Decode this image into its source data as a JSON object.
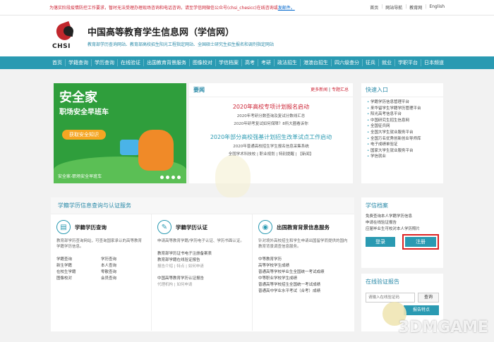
{
  "topbar": {
    "notice": "为落实阶段疫情防控工作要求，暂时无法受理办理现场咨询和电话咨询，请至学信网微信公众号(chsi_chesicc)在线咨询或",
    "notice_link": "发邮件。",
    "links": [
      "首页",
      "网站导航",
      "教育网",
      "English"
    ]
  },
  "header": {
    "logo_text": "CHSI",
    "title": "中国高等教育学生信息网（学信网）",
    "subtitle": "教育部学历查询网站、教育部高校招生阳光工程指定网站、全国硕士研究生招生报名和调剂指定网站"
  },
  "nav": [
    "首页",
    "学籍查询",
    "学历查询",
    "在线验证",
    "出国教育背景服务",
    "图像校对",
    "学信档案",
    "高考",
    "考研",
    "政法招生",
    "港澳台招生",
    "四六级查分",
    "征兵",
    "就业",
    "学职平台",
    "日本频道"
  ],
  "banner": {
    "title": "安全家",
    "subtitle": "职场安全早班车",
    "button": "获取安全知识",
    "caption": "安全家-职场安全早班车"
  },
  "news": {
    "heading": "要闻",
    "more": "更多新闻",
    "topics": "专题汇总",
    "headline1": "2020年高校专项计划报名启动",
    "items1": [
      "2020年考研分数查询及复试分数线汇总",
      "2020年研考复试如何保障？8所大圈看诉你"
    ],
    "headline2": "2020年部分高校强基计划招生改革试点工作启动",
    "items2": [
      "2020年普通高校招生学生报名信息采集系统",
      "全国学术科技校   |   职业规划   |   特别提醒   |   【新闻】"
    ]
  },
  "quick": {
    "heading": "快速入口",
    "items": [
      "学籍学历信息管理平台",
      "来华留学生学籍学历管理平台",
      "阳光高考信息平台",
      "中国研究生招生信息网",
      "全国征兵网",
      "全国大学生就业服务平台",
      "全国万名优秀创新创业导师库",
      "电子成绩单验证",
      "国家大学生就业服务平台",
      "学信就业"
    ]
  },
  "main": {
    "heading": "学籍学历信息查询与认证服务",
    "col1": {
      "title": "学籍学历查询",
      "desc": "教育部学历查询网站，可查询国家承认的高等教育学籍学历信息。",
      "links": [
        "学籍查询",
        "学历查询",
        "新生学籍",
        "本人查询",
        "在校生学籍",
        "零散查询",
        "图像校对",
        "会员查询"
      ]
    },
    "col2": {
      "title": "学籍学历认证",
      "desc": "申请高等教育学籍/学历电子认证、学历书面认证。",
      "link1": "教育部学历证书电子注册备案表",
      "link2": "教育部学籍在线验证报告",
      "sub1": "报告介绍  |  特点  |  如何申请",
      "link3": "中国高等教育学历认证报告",
      "sub2": "代理机构  |  如何申请"
    },
    "col3": {
      "title": "出国教育背景信息服务",
      "desc": "针对境外高校招生和学生申请出国留学而提供的国内教育背景调查信息服务。",
      "links": [
        "中等教育学历",
        "高等学校学生成绩",
        "普通高等学校毕业生全国统一考试成绩",
        "中等职业学校学生成绩",
        "普通高等学校招生全国统一考试成绩",
        "普通高中学业水平考试（合考）成绩"
      ]
    }
  },
  "archive": {
    "heading": "学信档案",
    "lines": [
      "免费查询本人学籍学历信息",
      "申请在线验证报告",
      "应届毕业生可校对本人学历照片"
    ],
    "login": "登录",
    "register": "注册"
  },
  "verify": {
    "heading": "在线验证报告",
    "placeholder": "请输入在线验证码",
    "query": "查询",
    "feature": "报告特点"
  },
  "watermark": "3DMGAME"
}
